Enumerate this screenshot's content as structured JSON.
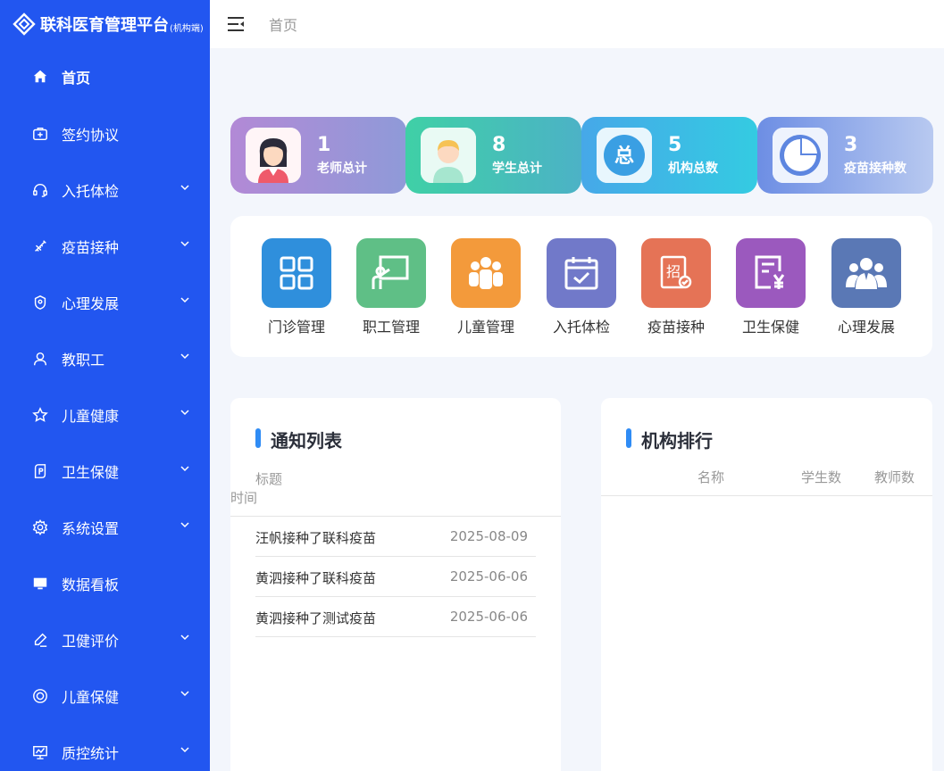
{
  "brand": {
    "title": "联科医育管理平台",
    "sub": "(机构端)"
  },
  "breadcrumb": "首页",
  "menu": [
    {
      "label": "首页",
      "icon": "home-icon",
      "active": true,
      "expandable": false
    },
    {
      "label": "签约协议",
      "icon": "medical-kit-icon",
      "expandable": false
    },
    {
      "label": "入托体检",
      "icon": "headset-icon",
      "expandable": true
    },
    {
      "label": "疫苗接种",
      "icon": "syringe-icon",
      "expandable": true
    },
    {
      "label": "心理发展",
      "icon": "shield-plus-icon",
      "expandable": true
    },
    {
      "label": "教职工",
      "icon": "user-icon",
      "expandable": true
    },
    {
      "label": "儿童健康",
      "icon": "star-icon",
      "expandable": true
    },
    {
      "label": "卫生保健",
      "icon": "tag-p-icon",
      "expandable": true
    },
    {
      "label": "系统设置",
      "icon": "gear-icon",
      "expandable": true
    },
    {
      "label": "数据看板",
      "icon": "monitor-icon",
      "expandable": false
    },
    {
      "label": "卫健评价",
      "icon": "pen-icon",
      "expandable": true
    },
    {
      "label": "儿童保健",
      "icon": "lifebuoy-icon",
      "expandable": true
    },
    {
      "label": "质控统计",
      "icon": "chart-board-icon",
      "expandable": true
    }
  ],
  "stats": [
    {
      "value": "1",
      "label": "老师总计",
      "icon": "teacher-avatar-icon"
    },
    {
      "value": "8",
      "label": "学生总计",
      "icon": "student-avatar-icon"
    },
    {
      "value": "5",
      "label": "机构总数",
      "icon": "zong-badge-icon"
    },
    {
      "value": "3",
      "label": "疫苗接种数",
      "icon": "pie-icon"
    }
  ],
  "quick": [
    {
      "label": "门诊管理",
      "color": "#2f8fdc",
      "icon": "grid-icon"
    },
    {
      "label": "职工管理",
      "color": "#5fbf86",
      "icon": "teacher-board-icon"
    },
    {
      "label": "儿童管理",
      "color": "#f39a3b",
      "icon": "group-icon"
    },
    {
      "label": "入托体检",
      "color": "#7179c9",
      "icon": "calendar-check-icon"
    },
    {
      "label": "疫苗接种",
      "color": "#e57356",
      "icon": "certificate-icon"
    },
    {
      "label": "卫生保健",
      "color": "#9b59be",
      "icon": "invoice-icon"
    },
    {
      "label": "心理发展",
      "color": "#5a78b5",
      "icon": "team-icon"
    }
  ],
  "notice": {
    "title": "通知列表",
    "col_title": "标题",
    "col_time": "时间",
    "rows": [
      {
        "title": "汪帆接种了联科疫苗",
        "time": "2025-08-09"
      },
      {
        "title": "黄泗接种了联科疫苗",
        "time": "2025-06-06"
      },
      {
        "title": "黄泗接种了测试疫苗",
        "time": "2025-06-06"
      }
    ]
  },
  "ranking": {
    "title": "机构排行",
    "col_name": "名称",
    "col_students": "学生数",
    "col_teachers": "教师数"
  }
}
